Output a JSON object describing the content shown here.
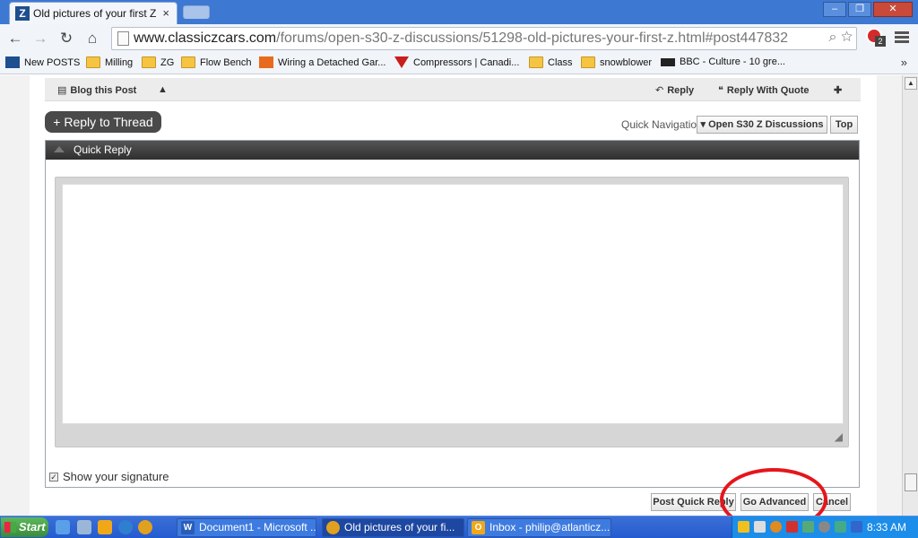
{
  "browser": {
    "tab_title": "Old pictures of your first Z",
    "tab_close": "×",
    "url_host": "www.classiczcars.com",
    "url_path": "/forums/open-s30-z-discussions/51298-old-pictures-your-first-z.html#post447832",
    "extension_badge": "2",
    "bookmarks": [
      {
        "label": "New POSTS"
      },
      {
        "label": "Milling"
      },
      {
        "label": "ZG"
      },
      {
        "label": "Flow Bench"
      },
      {
        "label": "Wiring a Detached Gar..."
      },
      {
        "label": "Compressors | Canadi..."
      },
      {
        "label": "Class"
      },
      {
        "label": "snowblower"
      },
      {
        "label": "BBC - Culture - 10 gre..."
      }
    ],
    "bookmarks_more": "»"
  },
  "postbar": {
    "blog_this_post": "Blog this Post",
    "reply": "Reply",
    "reply_with_quote": "Reply With Quote"
  },
  "thread": {
    "reply_to_thread": "+ Reply to Thread",
    "quick_navigation": "Quick Navigation",
    "nav_forum": "▾ Open S30 Z Discussions",
    "nav_top": "Top"
  },
  "quick_reply": {
    "title": "Quick Reply",
    "show_signature": "Show your signature",
    "signature_checked": "✓",
    "post_quick_reply": "Post Quick Reply",
    "go_advanced": "Go Advanced",
    "cancel": "Cancel"
  },
  "taskbar": {
    "start": "Start",
    "tasks": [
      {
        "label": "Document1 - Microsoft ...",
        "icon": "W"
      },
      {
        "label": "Old pictures of your fi...",
        "icon": ""
      },
      {
        "label": "Inbox - philip@atlanticz....",
        "icon": "O"
      }
    ],
    "clock": "8:33 AM"
  },
  "colors": {
    "annotation_circle": "#e5161b",
    "titlebar": "#3d78d2",
    "taskbar": "#245bd0"
  }
}
